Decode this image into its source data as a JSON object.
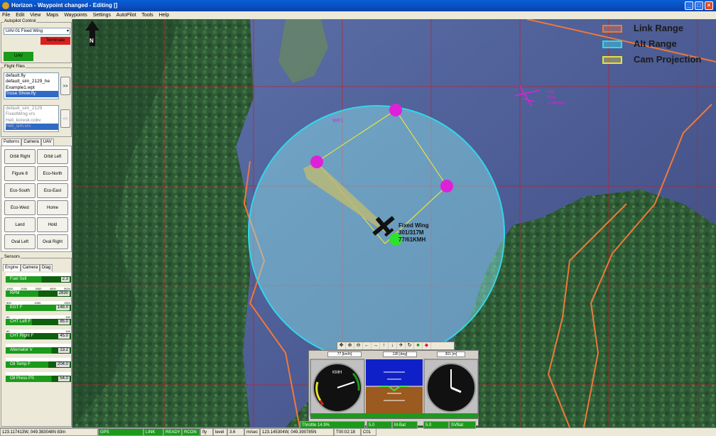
{
  "window": {
    "title": "Horizon - Waypoint changed - Editing []"
  },
  "menu": [
    "File",
    "Edit",
    "View",
    "Maps",
    "Waypoints",
    "Settings",
    "AutoPilot",
    "Tools",
    "Help"
  ],
  "autopilot": {
    "group_title": "Autopilot Control",
    "selected": "UAV-01 Fixed Wing",
    "terminate_label": "Terminate",
    "uav_label": "UAV"
  },
  "flight_files": {
    "group_title": "Flight Files",
    "files": [
      "default.fly",
      "default_sim_2129_he",
      "Example1.wpt",
      "Trose Show.fly"
    ],
    "selected_index": 3,
    "load_label": ">>",
    "vehicles": [
      "default_sim_2129",
      "FixedWing.vrs",
      "Heli_koresk.cobv",
      "Heli_sim.vrs"
    ],
    "vehicle_selected_index": 3,
    "unload_label": "<<"
  },
  "patterns": {
    "tabs": [
      "Patterns",
      "Camera",
      "UAV"
    ],
    "buttons": [
      "Orbit Right",
      "Orbit Left",
      "Figure 8",
      "Eco-North",
      "Eco-South",
      "Eco-East",
      "Eco-West",
      "Home",
      "Land",
      "Hold",
      "Oval Left",
      "Oval Right"
    ]
  },
  "sensors": {
    "group_title": "Sensors",
    "tabs": [
      "Engine",
      "Camera",
      "Diag"
    ],
    "items": [
      {
        "label": "Fuel Sell",
        "value": "2.3",
        "scale": [
          "",
          "",
          "",
          "",
          ""
        ],
        "fill": 0.55
      },
      {
        "label": "RPM",
        "value": "2830",
        "scale": [
          "1000",
          "2000",
          "3000",
          "4000",
          "5000"
        ],
        "fill": 0.5
      },
      {
        "label": "EGT F",
        "value": "148.0",
        "scale": [
          "500",
          "",
          "1000",
          "",
          "1500"
        ],
        "fill": 0.95
      },
      {
        "label": "CHT Left F",
        "value": "85.0",
        "scale": [
          "60",
          "",
          "",
          "",
          "150"
        ],
        "fill": 0.4
      },
      {
        "label": "CHT Right F",
        "value": "45.0",
        "scale": [
          "60",
          "",
          "",
          "",
          "150"
        ],
        "fill": 0.3
      },
      {
        "label": "Alternator V",
        "value": "13.2",
        "scale": [
          "",
          "",
          "",
          "",
          ""
        ],
        "fill": 0.7
      },
      {
        "label": "Oil Temp F",
        "value": "204.0",
        "scale": [
          "",
          "",
          "",
          "",
          ""
        ],
        "fill": 0.65
      },
      {
        "label": "Oil Press PS",
        "value": "54.0",
        "scale": [
          "",
          "",
          "",
          "",
          ""
        ],
        "fill": 0.7
      }
    ]
  },
  "legend": [
    {
      "label": "Link Range",
      "color": "#f07838"
    },
    {
      "label": "Alt Range",
      "color": "#30d8e8"
    },
    {
      "label": "Cam Projection",
      "color": "#e8e040"
    }
  ],
  "map": {
    "aircraft_label": [
      "Fixed Wing",
      "301/317M",
      "77/61KMH"
    ],
    "heli_label": [
      "Heli",
      "Hold",
      "1.36KMH"
    ],
    "waypoint_tag": "WP1",
    "north_label": "N"
  },
  "instruments": {
    "speed_header": "77 [km/h]",
    "heading_header": "135 [deg]",
    "alt_header": "301 [m]",
    "asi_unit": "KMH"
  },
  "status": [
    "123.117413W, 049.383048N  83m",
    "GPS",
    "LINK",
    "READY",
    "RCON",
    "fly",
    "level",
    "3.6",
    "m/sec",
    "123.145304W, 049.390785N",
    "T00:02:18",
    "C01",
    "Throttle 14.9%",
    "5.0",
    "M-Bat",
    "5.0",
    "SVBat"
  ]
}
